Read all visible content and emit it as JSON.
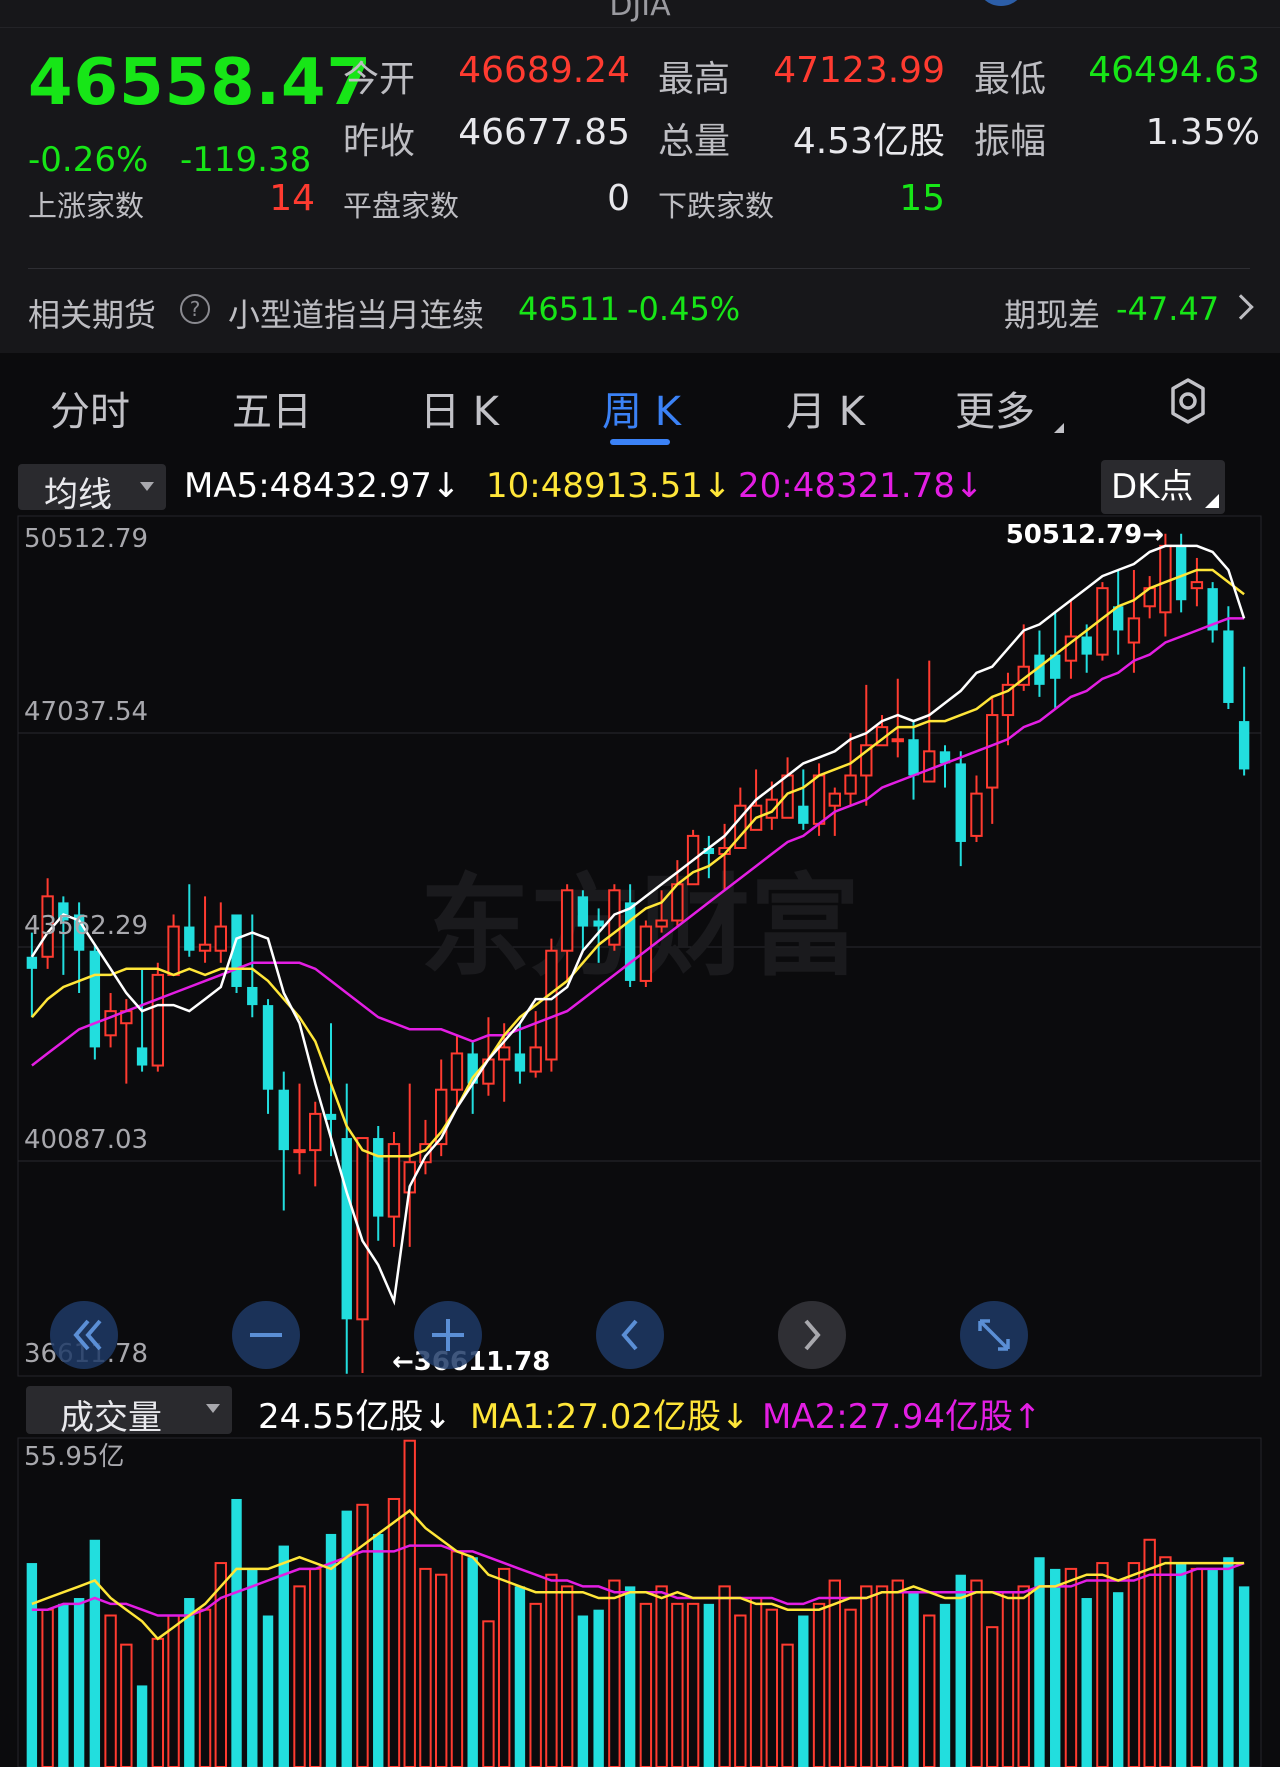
{
  "topbar": {
    "ticker": "DJIA"
  },
  "quote": {
    "price": "46558.47",
    "change_pct": "-0.26%",
    "change_abs": "-119.38",
    "open_label": "今开",
    "open_value": "46689.24",
    "high_label": "最高",
    "high_value": "47123.99",
    "low_label": "最低",
    "low_value": "46494.63",
    "prev_close_label": "昨收",
    "prev_close_value": "46677.85",
    "volume_label": "总量",
    "volume_value": "4.53亿股",
    "amplitude_label": "振幅",
    "amplitude_value": "1.35%",
    "advancers_label": "上涨家数",
    "advancers_value": "14",
    "unchanged_label": "平盘家数",
    "unchanged_value": "0",
    "decliners_label": "下跌家数",
    "decliners_value": "15"
  },
  "futures": {
    "label": "相关期货",
    "help_icon": "question-circle-icon",
    "contract": "小型道指当月连续",
    "price": "46511",
    "change": "-0.45%",
    "basis_label": "期现差",
    "basis_value": "-47.47"
  },
  "tabs": [
    {
      "label": "分时"
    },
    {
      "label": "五日"
    },
    {
      "label": "日 K"
    },
    {
      "label": "周 K",
      "active": true
    },
    {
      "label": "月 K"
    },
    {
      "label": "更多"
    }
  ],
  "ma_bar": {
    "selector": "均线",
    "ma5": "MA5:48432.97↓",
    "ma10": "10:48913.51↓",
    "ma20": "20:48321.78↓",
    "dk_button": "DK点"
  },
  "vol_bar": {
    "selector": "成交量",
    "current": "24.55亿股↓",
    "ma1": "MA1:27.02亿股↓",
    "ma2": "MA2:27.94亿股↑"
  },
  "colors": {
    "up": "#ff3b30",
    "down": "#22dede",
    "ma5": "#ffffff",
    "ma10": "#ffe639",
    "ma20": "#e31ee3",
    "accent": "#3b82f6",
    "price_green": "#17e617"
  },
  "chart_data": [
    {
      "type": "candlestick",
      "y_ticks": [
        "50512.79",
        "47037.54",
        "43562.29",
        "40087.03",
        "36611.78"
      ],
      "ylim": [
        36611.78,
        50512.79
      ],
      "high_annotation": "50512.79→",
      "low_annotation": "←36611.78",
      "watermark": "东方财富",
      "candles": [
        [
          43500,
          43300,
          43900,
          42500
        ],
        [
          43500,
          44500,
          44800,
          43300
        ],
        [
          44400,
          44100,
          44500,
          43200
        ],
        [
          44200,
          43600,
          44400,
          42900
        ],
        [
          43600,
          42000,
          43700,
          41800
        ],
        [
          42200,
          42600,
          42900,
          42000
        ],
        [
          42400,
          42600,
          42800,
          41400
        ],
        [
          42000,
          41700,
          43300,
          41600
        ],
        [
          41700,
          43200,
          43400,
          41600
        ],
        [
          43200,
          44000,
          44200,
          43200
        ],
        [
          44000,
          43600,
          44700,
          43500
        ],
        [
          43600,
          43700,
          44500,
          43400
        ],
        [
          43600,
          44000,
          44400,
          43400
        ],
        [
          44200,
          43000,
          44200,
          42900
        ],
        [
          43000,
          42700,
          44200,
          42500
        ],
        [
          42700,
          41300,
          42800,
          40900
        ],
        [
          41300,
          40300,
          41600,
          39300
        ],
        [
          40300,
          40300,
          41400,
          39900
        ],
        [
          40300,
          40900,
          41100,
          39700
        ],
        [
          40900,
          40800,
          42400,
          40200
        ],
        [
          40500,
          37500,
          41400,
          36600
        ],
        [
          37500,
          40500,
          40500,
          36611.78
        ],
        [
          40500,
          39200,
          40700,
          38800
        ],
        [
          39200,
          40400,
          40600,
          38700
        ],
        [
          39600,
          40100,
          41400,
          38700
        ],
        [
          40100,
          40400,
          40800,
          39900
        ],
        [
          40400,
          41300,
          41800,
          40200
        ],
        [
          41300,
          41900,
          42200,
          41000
        ],
        [
          41900,
          41400,
          42100,
          40900
        ],
        [
          41400,
          41800,
          42500,
          41200
        ],
        [
          41800,
          42000,
          42400,
          41100
        ],
        [
          41900,
          41600,
          42400,
          41400
        ],
        [
          41600,
          42000,
          42600,
          41500
        ],
        [
          41800,
          43600,
          43800,
          41600
        ],
        [
          43600,
          44600,
          44700,
          43100
        ],
        [
          44500,
          44000,
          44600,
          43600
        ],
        [
          44100,
          44000,
          44300,
          43400
        ],
        [
          43700,
          44600,
          44700,
          43600
        ],
        [
          44400,
          43100,
          44700,
          43000
        ],
        [
          43100,
          44000,
          44100,
          43000
        ],
        [
          44000,
          44100,
          44600,
          43900
        ],
        [
          44100,
          44700,
          45100,
          44000
        ],
        [
          44700,
          45500,
          45600,
          44700
        ],
        [
          45300,
          45200,
          45500,
          44800
        ],
        [
          45200,
          45300,
          45700,
          44600
        ],
        [
          45300,
          46000,
          46300,
          45300
        ],
        [
          45600,
          46000,
          46600,
          45600
        ],
        [
          45800,
          46100,
          46400,
          45600
        ],
        [
          45800,
          46500,
          46800,
          45800
        ],
        [
          46000,
          45700,
          46600,
          45600
        ],
        [
          45700,
          46500,
          46700,
          45500
        ],
        [
          46000,
          46200,
          46300,
          45500
        ],
        [
          46200,
          46500,
          47200,
          46000
        ],
        [
          46500,
          47000,
          48000,
          46000
        ],
        [
          47000,
          47300,
          47500,
          47000
        ],
        [
          47100,
          47100,
          48100,
          46800
        ],
        [
          47100,
          46500,
          47400,
          46100
        ],
        [
          46400,
          46900,
          48400,
          46400
        ],
        [
          46900,
          46700,
          47000,
          46300
        ],
        [
          46700,
          45400,
          46900,
          45000
        ],
        [
          45500,
          46200,
          46500,
          45400
        ],
        [
          46300,
          47500,
          47800,
          45700
        ],
        [
          47500,
          48000,
          48200,
          47000
        ],
        [
          48000,
          48300,
          49000,
          47900
        ],
        [
          48500,
          48000,
          48900,
          47800
        ],
        [
          48500,
          48100,
          49200,
          47600
        ],
        [
          48400,
          48800,
          49400,
          48100
        ],
        [
          48800,
          48500,
          49000,
          48200
        ],
        [
          48500,
          49600,
          49700,
          48400
        ],
        [
          49300,
          48900,
          49900,
          48500
        ],
        [
          48700,
          49100,
          49900,
          48200
        ],
        [
          49300,
          49600,
          49800,
          49100
        ],
        [
          49200,
          50300,
          50500,
          48800
        ],
        [
          50300,
          49400,
          50500,
          49200
        ],
        [
          49600,
          49700,
          50100,
          49300
        ],
        [
          49600,
          48900,
          49700,
          48700
        ],
        [
          48900,
          47700,
          49300,
          47600
        ],
        [
          47400,
          46600,
          48300,
          46500
        ]
      ],
      "ma5": [
        43500,
        43900,
        44200,
        44100,
        43700,
        43300,
        42900,
        42600,
        42700,
        42700,
        42600,
        42800,
        43000,
        43800,
        43900,
        43800,
        42900,
        42400,
        41400,
        40500,
        39600,
        38800,
        38400,
        37800,
        39700,
        40200,
        40500,
        41000,
        41400,
        41800,
        42100,
        42400,
        42800,
        42800,
        43000,
        43600,
        43900,
        44200,
        44300,
        44500,
        44700,
        44900,
        45100,
        45300,
        45500,
        45800,
        46100,
        46300,
        46500,
        46700,
        46800,
        46900,
        47100,
        47200,
        47400,
        47500,
        47400,
        47500,
        47700,
        47900,
        48200,
        48300,
        48600,
        48900,
        49000,
        49200,
        49400,
        49600,
        49800,
        49900,
        50000,
        50200,
        50300,
        50300,
        50300,
        50200,
        49900,
        49100
      ],
      "ma10": [
        42500,
        42800,
        43000,
        43100,
        43200,
        43200,
        43300,
        43300,
        43300,
        43200,
        43300,
        43200,
        43300,
        43300,
        43300,
        43100,
        42800,
        42500,
        42100,
        41400,
        40700,
        40300,
        40200,
        40200,
        40200,
        40300,
        40600,
        41000,
        41500,
        41800,
        42200,
        42500,
        42700,
        42900,
        43100,
        43400,
        43700,
        43900,
        44100,
        44300,
        44400,
        44700,
        44900,
        45000,
        45200,
        45500,
        45800,
        45900,
        46200,
        46300,
        46500,
        46600,
        46700,
        46900,
        47100,
        47300,
        47300,
        47400,
        47400,
        47500,
        47600,
        47800,
        47900,
        48100,
        48300,
        48500,
        48700,
        48900,
        49100,
        49300,
        49400,
        49600,
        49700,
        49800,
        49900,
        49900,
        49700,
        49500
      ],
      "ma20": [
        41700,
        41900,
        42100,
        42300,
        42400,
        42500,
        42600,
        42700,
        42800,
        42900,
        43000,
        43100,
        43200,
        43300,
        43400,
        43400,
        43400,
        43400,
        43300,
        43100,
        42900,
        42700,
        42500,
        42400,
        42300,
        42300,
        42300,
        42200,
        42100,
        42200,
        42200,
        42300,
        42400,
        42500,
        42600,
        42800,
        43000,
        43200,
        43400,
        43600,
        43800,
        44000,
        44200,
        44400,
        44600,
        44800,
        45000,
        45200,
        45400,
        45500,
        45700,
        45900,
        46000,
        46100,
        46300,
        46400,
        46500,
        46600,
        46700,
        46800,
        46900,
        47000,
        47100,
        47300,
        47400,
        47600,
        47800,
        47900,
        48100,
        48200,
        48400,
        48500,
        48700,
        48800,
        48900,
        49000,
        49100,
        49100
      ]
    },
    {
      "type": "bar",
      "y_ticks": [
        "55.95亿"
      ],
      "ylim": [
        0,
        55.95
      ],
      "volumes": [
        35,
        27,
        28,
        29,
        39,
        26,
        21,
        14,
        22,
        26,
        29,
        27,
        35,
        46,
        34,
        26,
        38,
        31,
        34,
        40,
        44,
        45,
        40,
        46,
        56,
        34,
        33,
        37,
        36,
        25,
        34,
        31,
        28,
        33,
        31,
        26,
        27,
        32,
        31,
        28,
        31,
        28,
        28,
        28,
        31,
        26,
        29,
        27,
        21,
        26,
        28,
        32,
        27,
        31,
        31,
        32,
        30,
        26,
        28,
        33,
        32,
        24,
        30,
        31,
        36,
        34,
        34,
        29,
        35,
        30,
        35,
        39,
        36,
        35,
        34,
        34,
        36,
        31
      ],
      "ma1": [
        28,
        29,
        30,
        31,
        32,
        29,
        27,
        25,
        22,
        24,
        26,
        28,
        31,
        34,
        34,
        34,
        35,
        36,
        35,
        34,
        36,
        38,
        40,
        42,
        44,
        41,
        39,
        37,
        36,
        33,
        32,
        31,
        30,
        30,
        30,
        30,
        29,
        29,
        30,
        30,
        29,
        30,
        29,
        29,
        29,
        29,
        28,
        28,
        27,
        27,
        27,
        28,
        29,
        29,
        30,
        30,
        31,
        30,
        29,
        29,
        30,
        30,
        29,
        29,
        31,
        31,
        32,
        33,
        33,
        32,
        33,
        34,
        35,
        35,
        35,
        35,
        35,
        35
      ],
      "ma2": [
        27,
        27,
        28,
        28,
        29,
        28,
        28,
        27,
        26,
        26,
        26,
        27,
        29,
        30,
        31,
        32,
        33,
        34,
        34,
        35,
        36,
        37,
        37,
        37,
        38,
        38,
        38,
        37,
        37,
        36,
        35,
        34,
        33,
        32,
        32,
        31,
        31,
        30,
        30,
        30,
        30,
        29,
        29,
        29,
        29,
        29,
        29,
        29,
        28,
        28,
        29,
        29,
        29,
        29,
        30,
        30,
        30,
        30,
        30,
        30,
        30,
        30,
        30,
        30,
        31,
        31,
        31,
        32,
        32,
        32,
        32,
        33,
        33,
        33,
        34,
        34,
        34,
        35
      ]
    }
  ],
  "toolbar": {
    "rewind": "double-chevron-left-icon",
    "zoom_out": "minus-icon",
    "zoom_in": "plus-icon",
    "prev": "chevron-left-icon",
    "next": "chevron-right-icon",
    "fullscreen": "expand-arrows-icon"
  }
}
